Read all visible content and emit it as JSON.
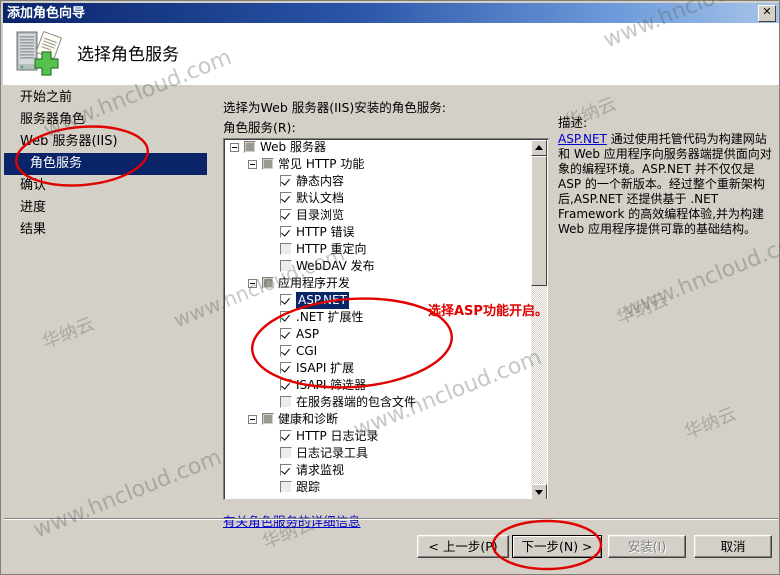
{
  "window": {
    "title": "添加角色向导",
    "close_label": "✕",
    "header_title": "选择角色服务",
    "header_icon": "server-add-icon"
  },
  "sidebar": {
    "items": [
      {
        "label": "开始之前",
        "selected": false
      },
      {
        "label": "服务器角色",
        "selected": false
      },
      {
        "label": "Web 服务器(IIS)",
        "selected": false
      },
      {
        "label": "角色服务",
        "selected": true
      },
      {
        "label": "确认",
        "selected": false
      },
      {
        "label": "进度",
        "selected": false
      },
      {
        "label": "结果",
        "selected": false
      }
    ]
  },
  "main": {
    "prompt": "选择为Web 服务器(IIS)安装的角色服务:",
    "tree_label": "角色服务(R):",
    "more_info_link": "有关角色服务的详细信息",
    "tree": [
      {
        "label": "Web 服务器",
        "indent": 0,
        "expander": true,
        "check": "partial",
        "selected": false
      },
      {
        "label": "常见 HTTP 功能",
        "indent": 1,
        "expander": true,
        "check": "partial",
        "selected": false
      },
      {
        "label": "静态内容",
        "indent": 2,
        "expander": false,
        "check": "checked",
        "selected": false
      },
      {
        "label": "默认文档",
        "indent": 2,
        "expander": false,
        "check": "checked",
        "selected": false
      },
      {
        "label": "目录浏览",
        "indent": 2,
        "expander": false,
        "check": "checked",
        "selected": false
      },
      {
        "label": "HTTP 错误",
        "indent": 2,
        "expander": false,
        "check": "checked",
        "selected": false
      },
      {
        "label": "HTTP 重定向",
        "indent": 2,
        "expander": false,
        "check": "unchecked",
        "selected": false
      },
      {
        "label": "WebDAV 发布",
        "indent": 2,
        "expander": false,
        "check": "unchecked",
        "selected": false
      },
      {
        "label": "应用程序开发",
        "indent": 1,
        "expander": true,
        "check": "partial",
        "selected": false
      },
      {
        "label": "ASP.NET",
        "indent": 2,
        "expander": false,
        "check": "checked",
        "selected": true
      },
      {
        "label": ".NET 扩展性",
        "indent": 2,
        "expander": false,
        "check": "checked",
        "selected": false
      },
      {
        "label": "ASP",
        "indent": 2,
        "expander": false,
        "check": "checked",
        "selected": false
      },
      {
        "label": "CGI",
        "indent": 2,
        "expander": false,
        "check": "checked",
        "selected": false
      },
      {
        "label": "ISAPI 扩展",
        "indent": 2,
        "expander": false,
        "check": "checked",
        "selected": false
      },
      {
        "label": "ISAPI 筛选器",
        "indent": 2,
        "expander": false,
        "check": "checked",
        "selected": false
      },
      {
        "label": "在服务器端的包含文件",
        "indent": 2,
        "expander": false,
        "check": "unchecked",
        "selected": false
      },
      {
        "label": "健康和诊断",
        "indent": 1,
        "expander": true,
        "check": "partial",
        "selected": false
      },
      {
        "label": "HTTP 日志记录",
        "indent": 2,
        "expander": false,
        "check": "checked",
        "selected": false
      },
      {
        "label": "日志记录工具",
        "indent": 2,
        "expander": false,
        "check": "unchecked",
        "selected": false
      },
      {
        "label": "请求监视",
        "indent": 2,
        "expander": false,
        "check": "checked",
        "selected": false
      },
      {
        "label": "跟踪",
        "indent": 2,
        "expander": false,
        "check": "unchecked",
        "selected": false
      }
    ],
    "description": {
      "label": "描述:",
      "link_text": "ASP.NET",
      "body": " 通过使用托管代码为构建网站和 Web 应用程序向服务器端提供面向对象的编程环境。ASP.NET 并不仅仅是 ASP 的一个新版本。经过整个重新架构后,ASP.NET 还提供基于 .NET Framework 的高效编程体验,并为构建 Web 应用程序提供可靠的基础结构。"
    }
  },
  "footer": {
    "back": "< 上一步(P)",
    "next": "下一步(N) >",
    "install": "安装(I)",
    "cancel": "取消"
  },
  "annotations": {
    "note_text": "选择ASP功能开启。",
    "color": "#e00000"
  },
  "watermarks": {
    "domain": "www.hncloud.com",
    "brand": "华纳云"
  }
}
